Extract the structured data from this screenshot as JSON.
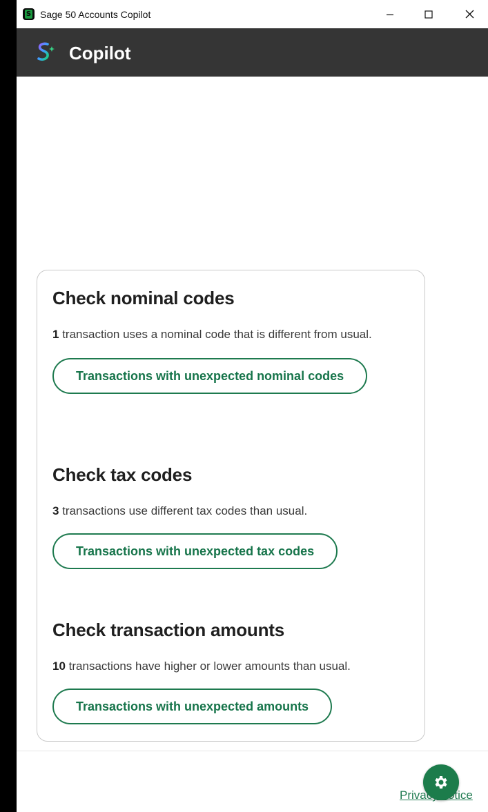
{
  "window": {
    "title": "Sage 50 Accounts Copilot",
    "controls": {
      "minimize": "minimize-icon",
      "maximize": "maximize-icon",
      "close": "close-icon"
    }
  },
  "header": {
    "title": "Copilot",
    "logo_icon": "sage-copilot-logo-icon"
  },
  "sections": [
    {
      "heading": "Check nominal codes",
      "count": "1",
      "description": " transaction uses a nominal code that is different from usual.",
      "button_label": "Transactions with unexpected nominal codes"
    },
    {
      "heading": "Check tax codes",
      "count": "3",
      "description": " transactions use different tax codes than usual.",
      "button_label": "Transactions with unexpected tax codes"
    },
    {
      "heading": "Check transaction amounts",
      "count": "10",
      "description": " transactions have higher or lower amounts than usual.",
      "button_label": "Transactions with unexpected amounts"
    }
  ],
  "footer": {
    "privacy_link": "Privacy notice",
    "settings_icon": "gear-icon"
  },
  "colors": {
    "accent": "#1e7a4f",
    "header_bg": "#353535",
    "button_text": "#16744a"
  }
}
